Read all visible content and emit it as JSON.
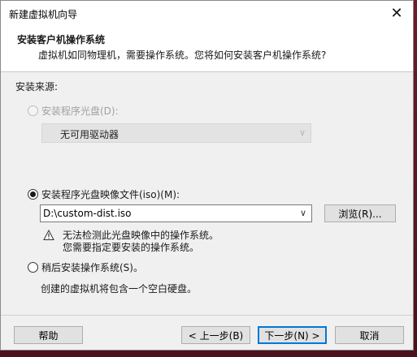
{
  "window": {
    "title": "新建虚拟机向导"
  },
  "header": {
    "title": "安装客户机操作系统",
    "subtitle": "虚拟机如同物理机，需要操作系统。您将如何安装客户机操作系统?"
  },
  "source": {
    "label": "安装来源:",
    "options": [
      {
        "label": "安装程序光盘(D):",
        "selected": false,
        "enabled": false
      },
      {
        "label": "安装程序光盘映像文件(iso)(M):",
        "selected": true,
        "enabled": true
      },
      {
        "label": "稍后安装操作系统(S)。",
        "selected": false,
        "enabled": true
      }
    ],
    "disc_drive_value": "无可用驱动器",
    "iso_path": "D:\\custom-dist.iso",
    "browse_label": "浏览(R)...",
    "warning_line1": "无法检测此光盘映像中的操作系统。",
    "warning_line2": "您需要指定要安装的操作系统。",
    "later_note": "创建的虚拟机将包含一个空白硬盘。"
  },
  "footer": {
    "help": "帮助",
    "back": "< 上一步(B)",
    "next": "下一步(N) >",
    "cancel": "取消"
  }
}
